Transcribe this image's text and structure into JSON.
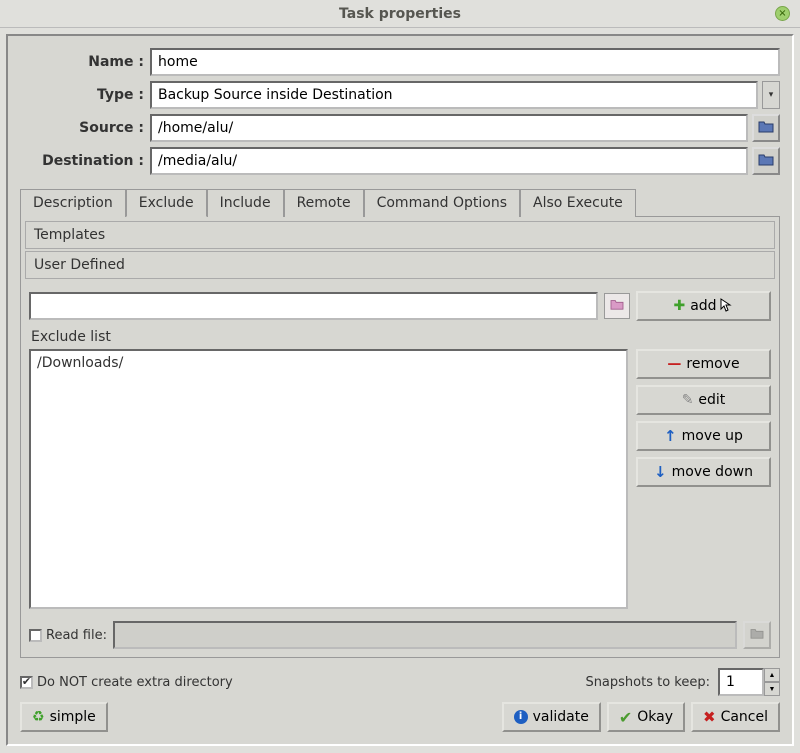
{
  "title": "Task properties",
  "fields": {
    "name_label": "Name :",
    "name_value": "home",
    "type_label": "Type :",
    "type_value": "Backup Source inside Destination",
    "source_label": "Source :",
    "source_value": "/home/alu/",
    "destination_label": "Destination :",
    "destination_value": "/media/alu/"
  },
  "tabs": {
    "description": "Description",
    "exclude": "Exclude",
    "include": "Include",
    "remote": "Remote",
    "command_options": "Command Options",
    "also_execute": "Also Execute"
  },
  "exclude": {
    "templates_header": "Templates",
    "user_defined_header": "User Defined",
    "add_input": "",
    "add_button": "add",
    "list_label": "Exclude list",
    "list_items": [
      "/Downloads/"
    ],
    "remove_button": "remove",
    "edit_button": "edit",
    "moveup_button": "move up",
    "movedown_button": "move down",
    "readfile_label": "Read file:",
    "readfile_checked": false,
    "readfile_value": ""
  },
  "options": {
    "no_extra_dir_label": "Do NOT create extra directory",
    "no_extra_dir_checked": true,
    "snapshots_label": "Snapshots to keep:",
    "snapshots_value": "1"
  },
  "footer": {
    "simple": "simple",
    "validate": "validate",
    "okay": "Okay",
    "cancel": "Cancel"
  }
}
